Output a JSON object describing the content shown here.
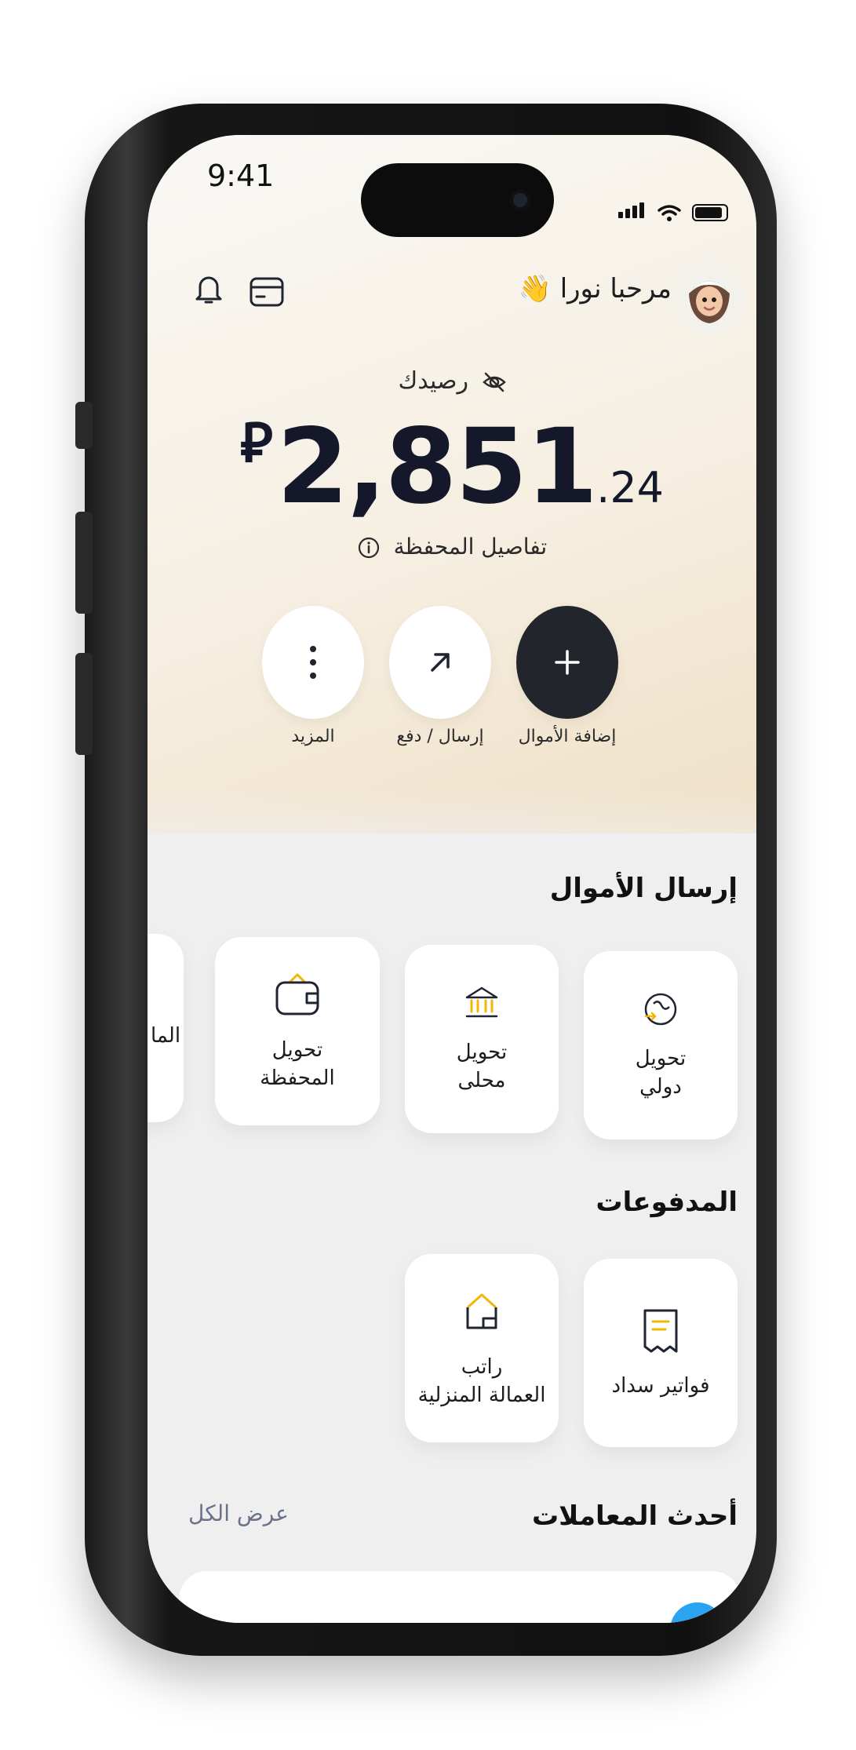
{
  "status": {
    "time": "9:41"
  },
  "header": {
    "greeting": "مرحبا نورا 👋"
  },
  "balance": {
    "label": "رصيدك",
    "currency": "⃁",
    "amount_main": "2,851",
    "amount_decimal": ".24",
    "details_link": "تفاصيل المحفظة"
  },
  "actions": [
    {
      "label": "إضافة الأموال",
      "icon": "plus-icon"
    },
    {
      "label": "إرسال / دفع",
      "icon": "arrow-up-right-icon"
    },
    {
      "label": "المزيد",
      "icon": "more-vertical-icon"
    }
  ],
  "send_money": {
    "title": "إرسال الأموال",
    "cards": [
      {
        "line1": "تحويل",
        "line2": "دولي",
        "icon": "globe-transfer-icon"
      },
      {
        "line1": "تحويل",
        "line2": "محلى",
        "icon": "bank-icon"
      },
      {
        "line1": "تحويل",
        "line2": "المحفظة",
        "icon": "wallet-icon"
      },
      {
        "line1": "الما",
        "line2": "",
        "icon": ""
      }
    ]
  },
  "payments": {
    "title": "المدفوعات",
    "cards": [
      {
        "line1": "فواتير سداد",
        "line2": "",
        "icon": "receipt-icon"
      },
      {
        "line1": "راتب",
        "line2": "العمالة المنزلية",
        "icon": "home-icon"
      }
    ]
  },
  "transactions": {
    "title": "أحدث المعاملات",
    "view_all": "عرض الكل"
  },
  "colors": {
    "accent": "#f2b705",
    "dark": "#22262c",
    "hero_start": "#f9f8f5",
    "hero_end": "#efe0c6"
  }
}
